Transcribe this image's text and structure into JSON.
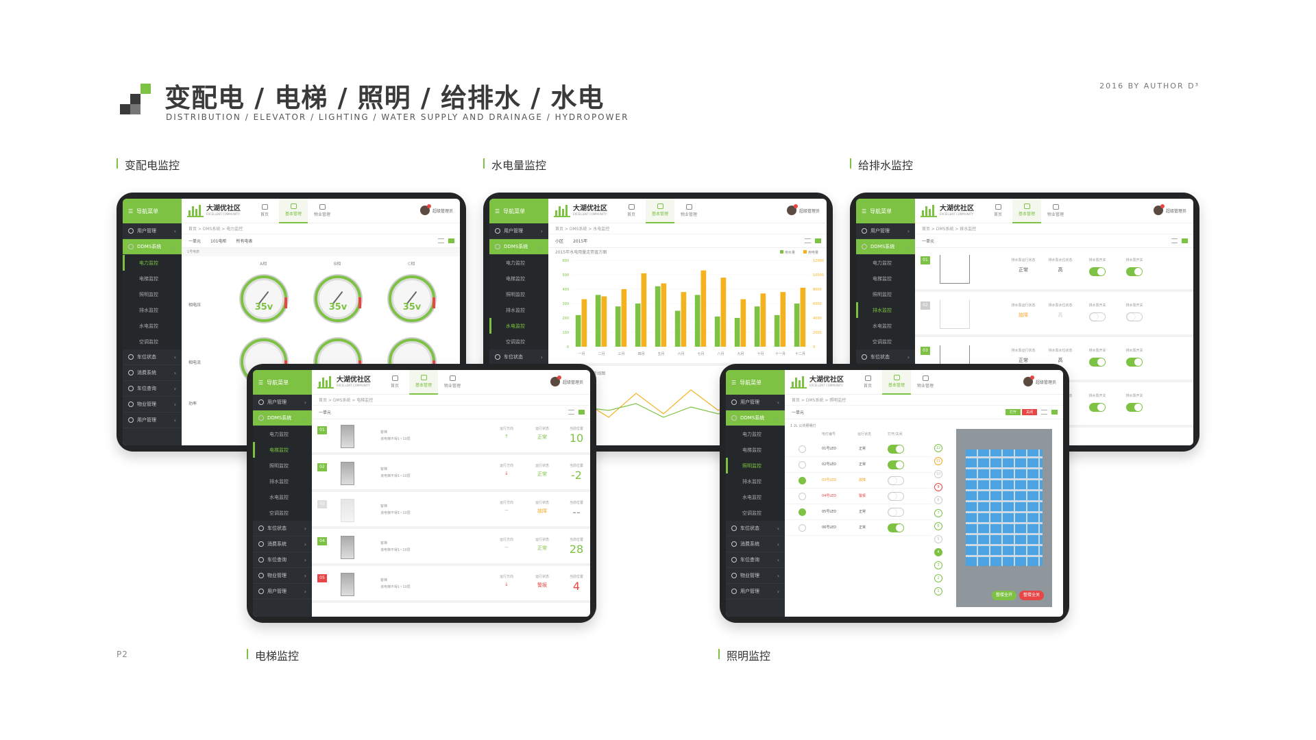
{
  "header": {
    "title": "变配电 / 电梯 / 照明 / 给排水 / 水电",
    "subtitle": "DISTRIBUTION / ELEVATOR / LIGHTING / WATER SUPPLY AND DRAINAGE / HYDROPOWER",
    "author": "2016 BY AUTHOR D³",
    "page_number": "P2"
  },
  "colors": {
    "accent": "#7dc242",
    "dark": "#2b2f33",
    "orange": "#f5a623",
    "red": "#e84545",
    "blue": "#4ba3e3"
  },
  "sections": {
    "power": "变配电监控",
    "water_power": "水电量监控",
    "drainage": "给排水监控",
    "elevator": "电梯监控",
    "lighting": "照明监控"
  },
  "app": {
    "brand": "大湖优社区",
    "brand_en": "EXCELLENT COMMUNITY",
    "user": "超级管理员",
    "tabs": [
      "首页",
      "基本管理",
      "物业管理"
    ],
    "sidebar": {
      "head": "导航菜单",
      "groups": [
        "用户管理",
        "DDMS系统"
      ],
      "subs": [
        "电力监控",
        "电梯监控",
        "照明监控",
        "排水监控",
        "水电监控",
        "空调监控"
      ],
      "bottom": [
        "车位状态",
        "消费系统",
        "车位查询",
        "物业管理",
        "用户管理"
      ]
    }
  },
  "power": {
    "crumb": "首页 > DMS系统 > 电力监控",
    "filters": [
      "一单元",
      "101电柜",
      "所有电表"
    ],
    "box_label": "1号电表",
    "columns": [
      "A相",
      "B相",
      "C相"
    ],
    "rows": [
      "相电压",
      "相电流",
      "功率"
    ],
    "gauge_label": "相电压",
    "gauge_values": [
      "35v",
      "35v",
      "35v"
    ],
    "footer": "2号电表"
  },
  "water_power": {
    "crumb": "首页 > DMS系统 > 水电监控",
    "filters": [
      "小区",
      "2015年"
    ],
    "chart_data": {
      "type": "bar",
      "title": "2015年水电用量走势直方图",
      "categories": [
        "一月",
        "二月",
        "三月",
        "四月",
        "五月",
        "六月",
        "七月",
        "八月",
        "九月",
        "十月",
        "十一月",
        "十二月"
      ],
      "series": [
        {
          "name": "用水量",
          "color": "#7dc242",
          "values": [
            220,
            360,
            280,
            300,
            420,
            250,
            360,
            210,
            200,
            280,
            220,
            300
          ]
        },
        {
          "name": "用电量",
          "color": "#f5b21f",
          "values": [
            330,
            350,
            400,
            510,
            440,
            380,
            530,
            480,
            330,
            370,
            380,
            410
          ]
        }
      ],
      "left_axis": [
        0,
        100,
        200,
        300,
        400,
        500,
        600
      ],
      "right_axis": [
        0,
        2000,
        4000,
        6000,
        8000,
        10000,
        12000
      ],
      "ylim": [
        0,
        600
      ]
    },
    "second_chart_title": "2015年水电用量走势折线图"
  },
  "drainage": {
    "crumb": "首页 > DMS系统 > 排水监控",
    "filter": "一单元",
    "col_labels": [
      "排水泵运行状态",
      "排水泵水位状态",
      "排水泵开关",
      "排水泵开关"
    ],
    "rows": [
      {
        "num": "01",
        "status": "正常",
        "level": "高",
        "sw1": true,
        "sw2": true,
        "on": true
      },
      {
        "num": "02",
        "status": "故障",
        "level": "高",
        "sw1": false,
        "sw2": false,
        "on": false
      },
      {
        "num": "03",
        "status": "正常",
        "level": "高",
        "sw1": true,
        "sw2": true,
        "on": true
      },
      {
        "num": "04",
        "status": "正常",
        "level": "高",
        "sw1": true,
        "sw2": true,
        "on": true
      }
    ]
  },
  "elevator": {
    "crumb": "首页 > DMS系统 > 电梯监控",
    "filter": "一单元",
    "labels": [
      "运行方向",
      "运行状态",
      "当前位置"
    ],
    "desc": "客梯",
    "desc2": "该电梯不得1~10层",
    "rows": [
      {
        "num": "01",
        "dir": "↑",
        "state": "正常",
        "floor": "10",
        "style": "green"
      },
      {
        "num": "02",
        "dir": "↓",
        "state": "正常",
        "floor": "-2",
        "style": "green"
      },
      {
        "num": "03",
        "dir": "--",
        "state": "故障",
        "floor": "--",
        "style": "off"
      },
      {
        "num": "04",
        "dir": "--",
        "state": "正常",
        "floor": "28",
        "style": "green"
      },
      {
        "num": "05",
        "dir": "↓",
        "state": "警报",
        "floor": "4",
        "style": "red"
      }
    ]
  },
  "lighting": {
    "crumb": "首页 > DMS系统 > 照明监控",
    "filter": "一单元",
    "btn_on": "打开",
    "btn_off": "关闭",
    "box_label": "1 2L 公共照明灯",
    "cols": [
      "电灯编号",
      "运行状态",
      "打开/关闭"
    ],
    "rows": [
      {
        "id": "01号LED",
        "state": "正常",
        "chk": false,
        "sw": true
      },
      {
        "id": "02号LED",
        "state": "正常",
        "chk": false,
        "sw": true
      },
      {
        "id": "03号LED",
        "state": "故障",
        "chk": true,
        "sw": false
      },
      {
        "id": "04号LED",
        "state": "警报",
        "chk": false,
        "sw": false
      },
      {
        "id": "05号LED",
        "state": "正常",
        "chk": true,
        "sw": false
      },
      {
        "id": "06号LED",
        "state": "正常",
        "chk": false,
        "sw": true
      }
    ],
    "floors": [
      "12",
      "11",
      "10",
      "9",
      "8",
      "7",
      "6",
      "5",
      "4",
      "3",
      "2",
      "1"
    ],
    "all_on": "整楼全开",
    "all_off": "整楼全关"
  }
}
